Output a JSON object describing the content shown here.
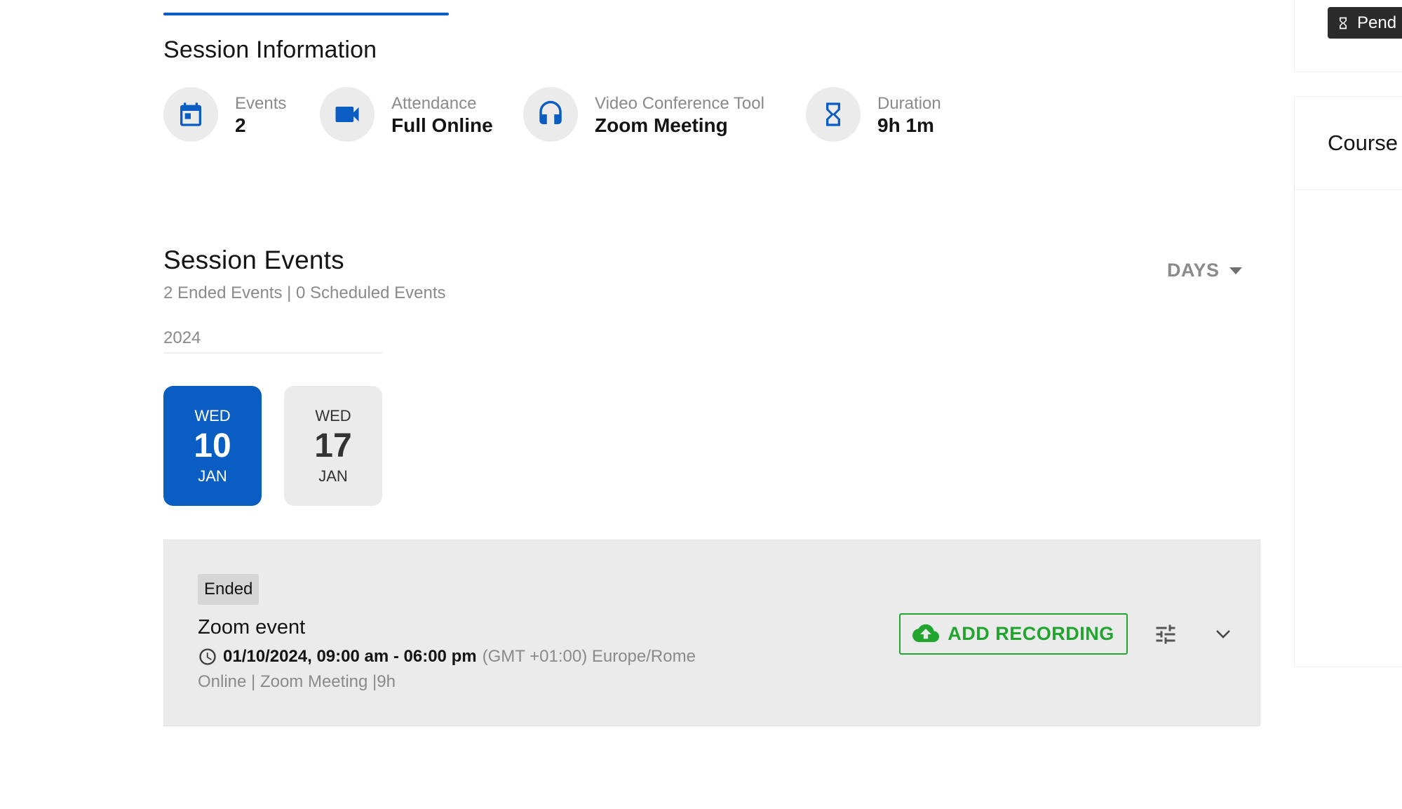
{
  "session_info": {
    "title": "Session Information",
    "items": [
      {
        "label": "Events",
        "value": "2",
        "icon": "calendar-icon"
      },
      {
        "label": "Attendance",
        "value": "Full Online",
        "icon": "video-camera-icon"
      },
      {
        "label": "Video Conference Tool",
        "value": "Zoom Meeting",
        "icon": "headset-icon"
      },
      {
        "label": "Duration",
        "value": "9h 1m",
        "icon": "hourglass-icon"
      }
    ]
  },
  "session_events": {
    "title": "Session Events",
    "subtitle": "2 Ended Events | 0 Scheduled Events",
    "view_selector": "DAYS",
    "year": "2024",
    "days": [
      {
        "dow": "WED",
        "day": "10",
        "month": "JAN",
        "selected": true
      },
      {
        "dow": "WED",
        "day": "17",
        "month": "JAN",
        "selected": false
      }
    ]
  },
  "event": {
    "status": "Ended",
    "title": "Zoom event",
    "time": "01/10/2024, 09:00 am - 06:00 pm",
    "timezone": "(GMT +01:00) Europe/Rome",
    "meta": "Online | Zoom Meeting |9h",
    "add_recording_label": "ADD RECORDING"
  },
  "side_panel": {
    "badge": "Pend",
    "heading": "Course"
  },
  "colors": {
    "primary": "#0a5dc2",
    "success": "#22a52f",
    "muted_text": "#8a8a8a",
    "panel_bg": "#ebebeb"
  }
}
